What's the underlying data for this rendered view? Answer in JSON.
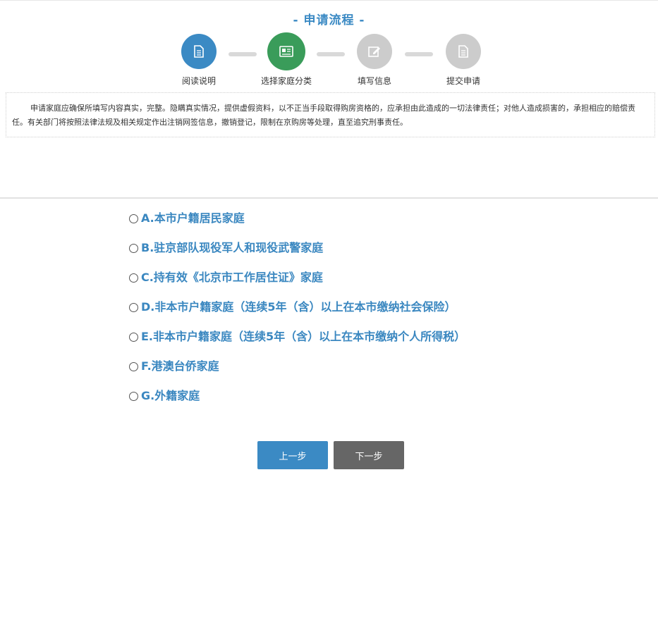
{
  "header": {
    "title": "- 申请流程 -"
  },
  "steps": [
    {
      "label": "阅读说明",
      "icon": "document-icon",
      "color": "#3b8ac4",
      "state": "done"
    },
    {
      "label": "选择家庭分类",
      "icon": "id-card-icon",
      "color": "#3a9c5a",
      "state": "active"
    },
    {
      "label": "填写信息",
      "icon": "edit-icon",
      "color": "#cccccc",
      "state": "pending"
    },
    {
      "label": "提交申请",
      "icon": "document-icon",
      "color": "#cccccc",
      "state": "pending"
    }
  ],
  "notice": {
    "text": "申请家庭应确保所填写内容真实，完整。隐瞒真实情况，提供虚假资料，以不正当手段取得购房资格的，应承担由此造成的一切法律责任；对他人造成损害的，承担相应的赔偿责任。有关部门将按照法律法规及相关规定作出注销网签信息，撤销登记，限制在京购房等处理，直至追究刑事责任。"
  },
  "options": [
    {
      "label": "A.本市户籍居民家庭"
    },
    {
      "label": "B.驻京部队现役军人和现役武警家庭"
    },
    {
      "label": "C.持有效《北京市工作居住证》家庭"
    },
    {
      "label": "D.非本市户籍家庭（连续5年（含）以上在本市缴纳社会保险）"
    },
    {
      "label": "E.非本市户籍家庭（连续5年（含）以上在本市缴纳个人所得税）"
    },
    {
      "label": "F.港澳台侨家庭"
    },
    {
      "label": "G.外籍家庭"
    }
  ],
  "buttons": {
    "prev": "上一步",
    "next": "下一步"
  }
}
